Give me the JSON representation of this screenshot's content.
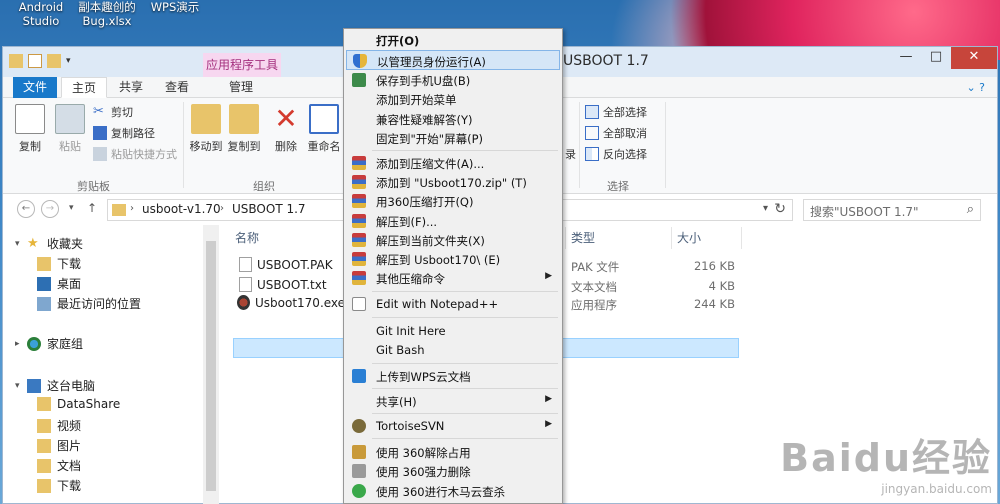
{
  "desktop": {
    "icons": [
      {
        "label1": "Android",
        "label2": "Studio"
      },
      {
        "label1": "副本趣创的",
        "label2": "Bug.xlsx"
      },
      {
        "label1": "WPS演示",
        "label2": ""
      }
    ]
  },
  "window": {
    "title": "USBOOT 1.7",
    "context_tab_header": "应用程序工具",
    "controls": {
      "minimize": "—",
      "maximize": "□",
      "close": "✕"
    }
  },
  "tabs": {
    "file": "文件",
    "home": "主页",
    "share": "共享",
    "view": "查看",
    "manage": "管理"
  },
  "ribbon": {
    "clipboard": {
      "copy": "复制",
      "paste": "粘贴",
      "cut": "剪切",
      "copy_path": "复制路径",
      "paste_shortcut": "粘贴快捷方式",
      "label": "剪贴板"
    },
    "organize": {
      "move_to": "移动到",
      "copy_to": "复制到",
      "delete": "删除",
      "rename": "重命名",
      "label": "组织"
    },
    "open_group": {
      "partial": "录"
    },
    "select": {
      "select_all": "全部选择",
      "select_none": "全部取消",
      "invert": "反向选择",
      "label": "选择"
    }
  },
  "address": {
    "crumbs": [
      "usboot-v1.70",
      "USBOOT 1.7"
    ],
    "search_placeholder": "搜索\"USBOOT 1.7\""
  },
  "nav_pane": {
    "favorites": "收藏夹",
    "downloads": "下载",
    "desktop": "桌面",
    "recent": "最近访问的位置",
    "homegroup": "家庭组",
    "this_pc": "这台电脑",
    "datashare": "DataShare",
    "videos": "视频",
    "pictures": "图片",
    "documents": "文档",
    "downloads2": "下载"
  },
  "columns": {
    "name": "名称",
    "type": "类型",
    "size": "大小"
  },
  "files": [
    {
      "name": "USBOOT.PAK",
      "type": "PAK 文件",
      "size": "216 KB"
    },
    {
      "name": "USBOOT.txt",
      "type": "文本文档",
      "size": "4 KB"
    },
    {
      "name": "Usboot170.exe",
      "type": "应用程序",
      "size": "244 KB"
    }
  ],
  "context_menu": {
    "items": [
      {
        "label": "打开(O)"
      },
      {
        "label": "以管理员身份运行(A)"
      },
      {
        "label": "保存到手机U盘(B)"
      },
      {
        "label": "添加到开始菜单"
      },
      {
        "label": "兼容性疑难解答(Y)"
      },
      {
        "label": "固定到\"开始\"屏幕(P)"
      },
      {
        "label": "添加到压缩文件(A)..."
      },
      {
        "label": "添加到 \"Usboot170.zip\" (T)"
      },
      {
        "label": "用360压缩打开(Q)"
      },
      {
        "label": "解压到(F)..."
      },
      {
        "label": "解压到当前文件夹(X)"
      },
      {
        "label": "解压到 Usboot170\\ (E)"
      },
      {
        "label": "其他压缩命令"
      },
      {
        "label": "Edit with Notepad++"
      },
      {
        "label": "Git Init Here"
      },
      {
        "label": "Git Bash"
      },
      {
        "label": "上传到WPS云文档"
      },
      {
        "label": "共享(H)"
      },
      {
        "label": "TortoiseSVN"
      },
      {
        "label": "使用 360解除占用"
      },
      {
        "label": "使用 360强力删除"
      },
      {
        "label": "使用 360进行木马云查杀"
      }
    ]
  },
  "watermark": {
    "logo": "Baidu经验",
    "url": "jingyan.baidu.com"
  }
}
